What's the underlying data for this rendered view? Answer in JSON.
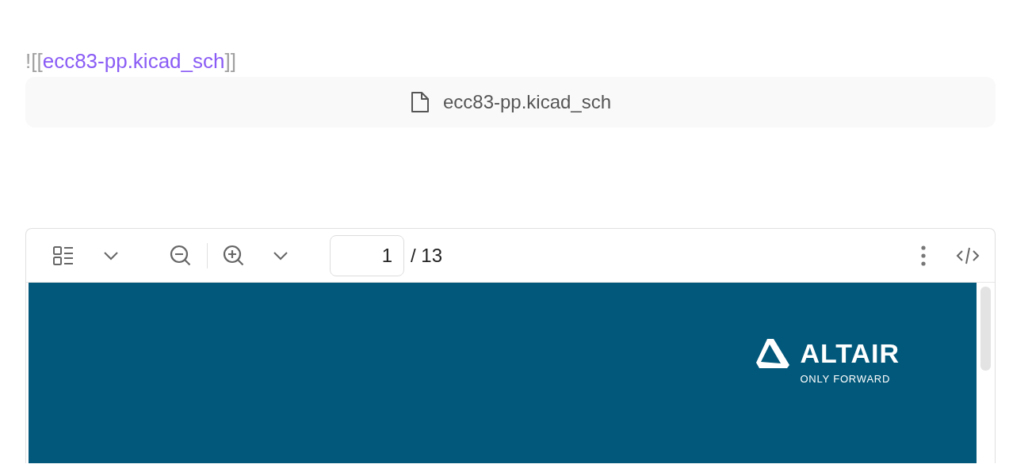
{
  "embed": {
    "prefix": "![[",
    "link": "ecc83-pp.kicad_sch",
    "suffix": "]]"
  },
  "file_card": {
    "name": "ecc83-pp.kicad_sch"
  },
  "pdf_viewer": {
    "page_input": {
      "value": "1"
    },
    "page_count": "/ 13",
    "page": {
      "logo_name": "ALTAIR",
      "tagline": "ONLY FORWARD"
    }
  }
}
